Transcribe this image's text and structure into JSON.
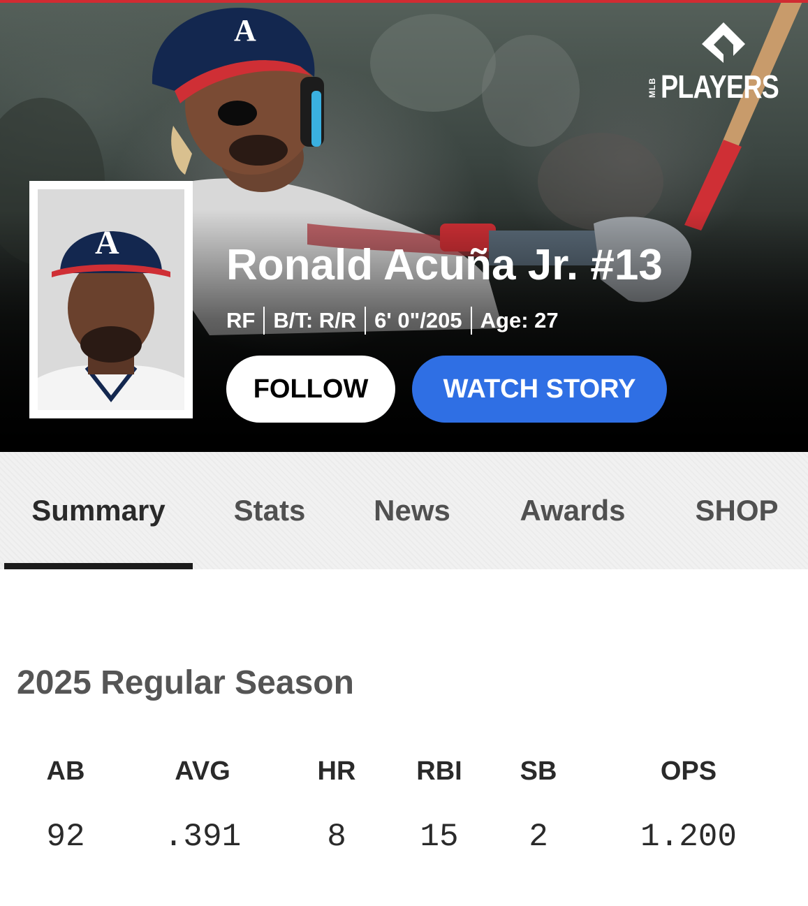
{
  "brand": {
    "prefix": "MLB",
    "wordmark": "PLAYERS"
  },
  "player": {
    "name": "Ronald Acuña Jr. #13",
    "position": "RF",
    "bats_throws": "B/T: R/R",
    "height_weight": "6' 0\"/205",
    "age": "Age: 27"
  },
  "actions": {
    "follow_label": "FOLLOW",
    "watch_story_label": "WATCH STORY"
  },
  "tabs": [
    {
      "label": "Summary",
      "active": true
    },
    {
      "label": "Stats",
      "active": false
    },
    {
      "label": "News",
      "active": false
    },
    {
      "label": "Awards",
      "active": false
    },
    {
      "label": "SHOP",
      "active": false
    }
  ],
  "season": {
    "title": "2025 Regular Season",
    "headers": [
      "AB",
      "AVG",
      "HR",
      "RBI",
      "SB",
      "OPS"
    ],
    "values": [
      "92",
      ".391",
      "8",
      "15",
      "2",
      "1.200"
    ]
  },
  "colors": {
    "accent_red": "#d12b32",
    "watch_story_blue": "#2f6fe4",
    "tab_underline": "#1c1c1c",
    "team_navy": "#13274f"
  }
}
